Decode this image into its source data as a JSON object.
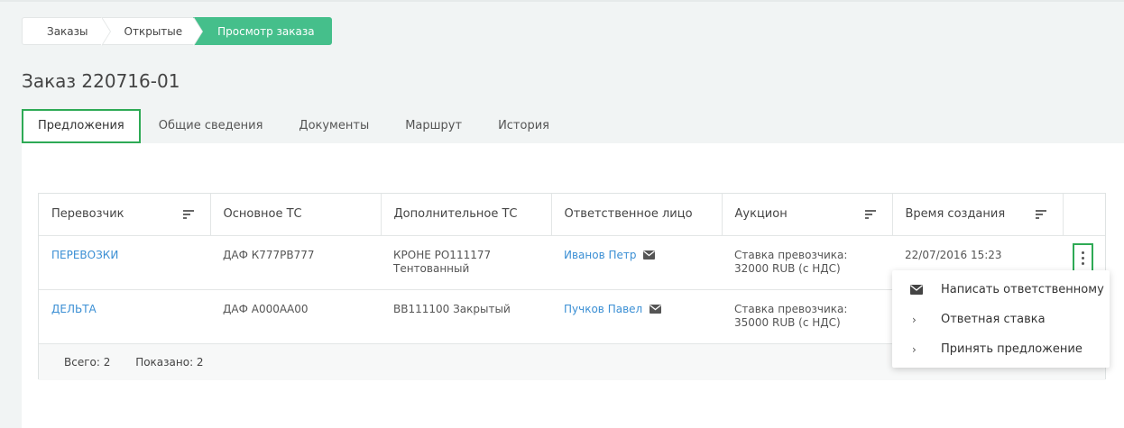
{
  "breadcrumb": [
    "Заказы",
    "Открытые",
    "Просмотр заказа"
  ],
  "title": "Заказ 220716-01",
  "tabs": [
    "Предложения",
    "Общие сведения",
    "Документы",
    "Маршрут",
    "История"
  ],
  "table": {
    "headers": [
      "Перевозчик",
      "Основное ТС",
      "Дополнительное ТС",
      "Ответственное лицо",
      "Аукцион",
      "Время создания"
    ],
    "rows": [
      {
        "carrier": "ПЕРЕВОЗКИ",
        "main_vehicle": "ДАФ К777РВ777",
        "extra_vehicle_1": "КРОНЕ РО111177",
        "extra_vehicle_2": "Тентованный",
        "contact": "Иванов Петр",
        "auction_1": "Ставка превозчика:",
        "auction_2": "32000 RUB (с НДС)",
        "created": "22/07/2016 15:23"
      },
      {
        "carrier": "ДЕЛЬТА",
        "main_vehicle": "ДАФ А000АА00",
        "extra_vehicle_1": "ВВ111100 Закрытый",
        "extra_vehicle_2": "",
        "contact": "Пучков Павел",
        "auction_1": "Ставка превозчика:",
        "auction_2": "35000 RUB (с НДС)",
        "created": ""
      }
    ],
    "footer": {
      "total": "Всего: 2",
      "shown": "Показано: 2"
    }
  },
  "menu": {
    "items": [
      {
        "label": "Написать ответственному",
        "icon": "mail-icon"
      },
      {
        "label": "Ответная ставка",
        "icon": "chevron-right-icon"
      },
      {
        "label": "Принять предложение",
        "icon": "chevron-right-icon"
      }
    ]
  },
  "colors": {
    "accent": "#45bf8b",
    "link": "#3b8fd4",
    "highlight": "#2eaa55"
  }
}
